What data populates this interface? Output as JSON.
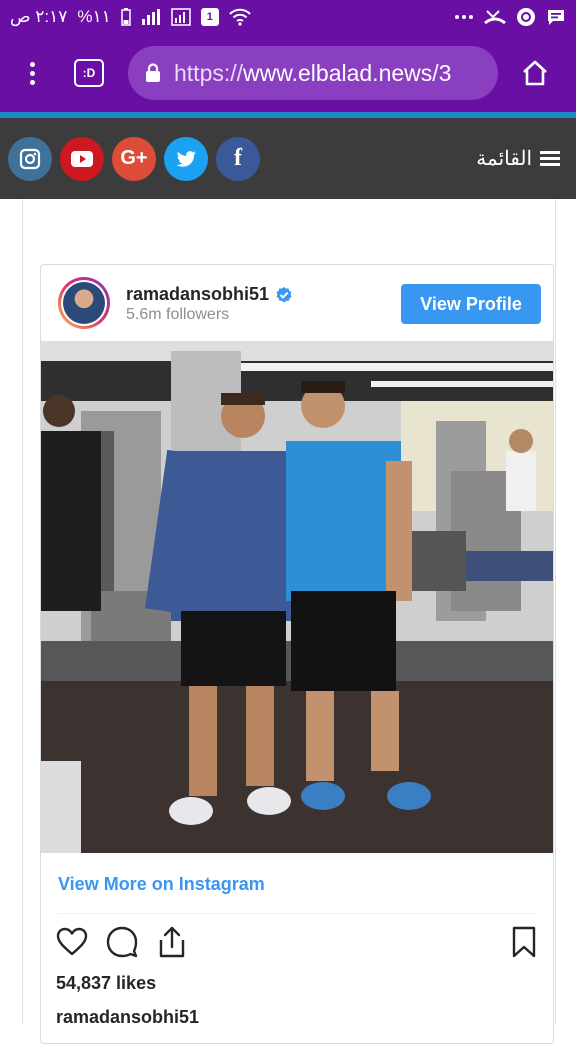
{
  "status_bar": {
    "time": "٢:١٧ ص",
    "battery": "%١١",
    "sim_badge": "1"
  },
  "browser": {
    "tabs_label": ":D",
    "url_scheme": "https://",
    "url_host": "www.elbalad.news/3"
  },
  "site_nav": {
    "menu_label": "القائمة",
    "social_icons": [
      "instagram-icon",
      "youtube-icon",
      "google-plus-icon",
      "twitter-icon",
      "facebook-icon"
    ],
    "google_plus_label": "G+",
    "facebook_label": "f"
  },
  "instagram": {
    "username": "ramadansobhi51",
    "followers": "5.6m followers",
    "view_profile": "View Profile",
    "view_more": "View More on Instagram",
    "likes": "54,837 likes",
    "caption_user": "ramadansobhi51"
  },
  "colors": {
    "browser_purple": "#6a0fa3",
    "site_accent": "#1e88c7",
    "site_nav_bg": "#3c3c3c",
    "instagram_blue": "#3897f0",
    "instagram_social": "#3f729b",
    "youtube_social": "#cc181e",
    "google_plus_social": "#dd4b39",
    "twitter_social": "#1da1f2",
    "facebook_social": "#3b5998"
  }
}
